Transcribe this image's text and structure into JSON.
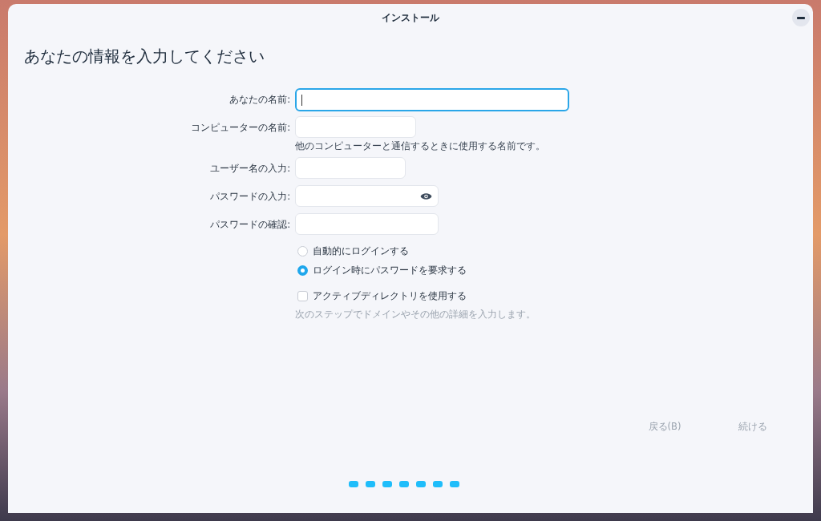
{
  "window": {
    "title": "インストール"
  },
  "heading": "あなたの情報を入力してください",
  "fields": [
    {
      "label": "あなたの名前:",
      "focused": true,
      "kind": "text"
    },
    {
      "label": "コンピューターの名前:",
      "focused": false,
      "kind": "text",
      "hint": "他のコンピューターと通信するときに使用する名前です。"
    },
    {
      "label": "ユーザー名の入力:",
      "focused": false,
      "kind": "text"
    },
    {
      "label": "パスワードの入力:",
      "focused": false,
      "kind": "password"
    },
    {
      "label": "パスワードの確認:",
      "focused": false,
      "kind": "text"
    }
  ],
  "login_options": [
    {
      "label": "自動的にログインする",
      "selected": false
    },
    {
      "label": "ログイン時にパスワードを要求する",
      "selected": true
    }
  ],
  "active_directory": {
    "label": "アクティブディレクトリを使用する",
    "checked": false,
    "hint": "次のステップでドメインやその他の詳細を入力します。"
  },
  "buttons": [
    {
      "label": "戻る(B)",
      "disabled": true
    },
    {
      "label": "続ける",
      "disabled": true
    }
  ],
  "page_dots": [
    {
      "filled": true
    },
    {
      "filled": true
    },
    {
      "filled": true
    },
    {
      "filled": true
    },
    {
      "filled": true
    },
    {
      "filled": true
    },
    {
      "filled": true
    }
  ]
}
